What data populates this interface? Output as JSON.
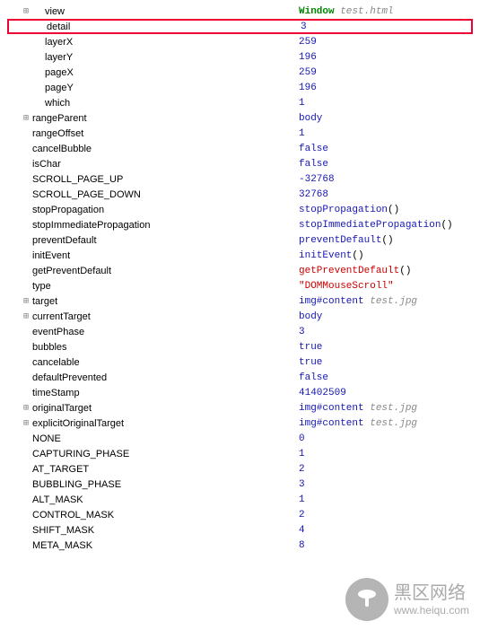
{
  "rows": [
    {
      "k": "view",
      "toggle": true,
      "indent": 0,
      "highlight": false,
      "parts": [
        {
          "t": "Window",
          "c": "v-green"
        },
        {
          "t": " test.html",
          "c": "v-gray"
        }
      ]
    },
    {
      "k": "detail",
      "toggle": false,
      "indent": 0,
      "highlight": true,
      "parts": [
        {
          "t": "3",
          "c": "v-num"
        }
      ]
    },
    {
      "k": "layerX",
      "toggle": false,
      "indent": 0,
      "highlight": false,
      "parts": [
        {
          "t": "259",
          "c": "v-num"
        }
      ]
    },
    {
      "k": "layerY",
      "toggle": false,
      "indent": 0,
      "highlight": false,
      "parts": [
        {
          "t": "196",
          "c": "v-num"
        }
      ]
    },
    {
      "k": "pageX",
      "toggle": false,
      "indent": 0,
      "highlight": false,
      "parts": [
        {
          "t": "259",
          "c": "v-num"
        }
      ]
    },
    {
      "k": "pageY",
      "toggle": false,
      "indent": 0,
      "highlight": false,
      "parts": [
        {
          "t": "196",
          "c": "v-num"
        }
      ]
    },
    {
      "k": "which",
      "toggle": false,
      "indent": 0,
      "highlight": false,
      "parts": [
        {
          "t": "1",
          "c": "v-num"
        }
      ]
    },
    {
      "k": "rangeParent",
      "toggle": true,
      "indent": -1,
      "highlight": false,
      "parts": [
        {
          "t": "body",
          "c": "v-num"
        }
      ]
    },
    {
      "k": "rangeOffset",
      "toggle": false,
      "indent": -1,
      "highlight": false,
      "parts": [
        {
          "t": "1",
          "c": "v-num"
        }
      ]
    },
    {
      "k": "cancelBubble",
      "toggle": false,
      "indent": -1,
      "highlight": false,
      "parts": [
        {
          "t": "false",
          "c": "v-bool"
        }
      ]
    },
    {
      "k": "isChar",
      "toggle": false,
      "indent": -1,
      "highlight": false,
      "parts": [
        {
          "t": "false",
          "c": "v-bool"
        }
      ]
    },
    {
      "k": "SCROLL_PAGE_UP",
      "toggle": false,
      "indent": -1,
      "highlight": false,
      "parts": [
        {
          "t": "-32768",
          "c": "v-num"
        }
      ]
    },
    {
      "k": "SCROLL_PAGE_DOWN",
      "toggle": false,
      "indent": -1,
      "highlight": false,
      "parts": [
        {
          "t": "32768",
          "c": "v-num"
        }
      ]
    },
    {
      "k": "stopPropagation",
      "toggle": false,
      "indent": -1,
      "highlight": false,
      "parts": [
        {
          "t": "stopPropagation",
          "c": "v-fn"
        },
        {
          "t": "()",
          "c": ""
        }
      ]
    },
    {
      "k": "stopImmediatePropagation",
      "toggle": false,
      "indent": -1,
      "highlight": false,
      "parts": [
        {
          "t": "stopImmediatePropagation",
          "c": "v-fn"
        },
        {
          "t": "()",
          "c": ""
        }
      ]
    },
    {
      "k": "preventDefault",
      "toggle": false,
      "indent": -1,
      "highlight": false,
      "parts": [
        {
          "t": "preventDefault",
          "c": "v-fn"
        },
        {
          "t": "()",
          "c": ""
        }
      ]
    },
    {
      "k": "initEvent",
      "toggle": false,
      "indent": -1,
      "highlight": false,
      "parts": [
        {
          "t": "initEvent",
          "c": "v-fn"
        },
        {
          "t": "()",
          "c": ""
        }
      ]
    },
    {
      "k": "getPreventDefault",
      "toggle": false,
      "indent": -1,
      "highlight": false,
      "parts": [
        {
          "t": "getPreventDefault",
          "c": "v-red-fn"
        },
        {
          "t": "()",
          "c": ""
        }
      ]
    },
    {
      "k": "type",
      "toggle": false,
      "indent": -1,
      "highlight": false,
      "parts": [
        {
          "t": "\"DOMMouseScroll\"",
          "c": "v-str"
        }
      ]
    },
    {
      "k": "target",
      "toggle": true,
      "indent": -1,
      "highlight": false,
      "parts": [
        {
          "t": "img#content",
          "c": "v-num"
        },
        {
          "t": " test.jpg",
          "c": "v-gray"
        }
      ]
    },
    {
      "k": "currentTarget",
      "toggle": true,
      "indent": -1,
      "highlight": false,
      "parts": [
        {
          "t": "body",
          "c": "v-num"
        }
      ]
    },
    {
      "k": "eventPhase",
      "toggle": false,
      "indent": -1,
      "highlight": false,
      "parts": [
        {
          "t": "3",
          "c": "v-num"
        }
      ]
    },
    {
      "k": "bubbles",
      "toggle": false,
      "indent": -1,
      "highlight": false,
      "parts": [
        {
          "t": "true",
          "c": "v-bool"
        }
      ]
    },
    {
      "k": "cancelable",
      "toggle": false,
      "indent": -1,
      "highlight": false,
      "parts": [
        {
          "t": "true",
          "c": "v-bool"
        }
      ]
    },
    {
      "k": "defaultPrevented",
      "toggle": false,
      "indent": -1,
      "highlight": false,
      "parts": [
        {
          "t": "false",
          "c": "v-bool"
        }
      ]
    },
    {
      "k": "timeStamp",
      "toggle": false,
      "indent": -1,
      "highlight": false,
      "parts": [
        {
          "t": "41402509",
          "c": "v-num"
        }
      ]
    },
    {
      "k": "originalTarget",
      "toggle": true,
      "indent": -1,
      "highlight": false,
      "parts": [
        {
          "t": "img#content",
          "c": "v-num"
        },
        {
          "t": " test.jpg",
          "c": "v-gray"
        }
      ]
    },
    {
      "k": "explicitOriginalTarget",
      "toggle": true,
      "indent": -1,
      "highlight": false,
      "parts": [
        {
          "t": "img#content",
          "c": "v-num"
        },
        {
          "t": " test.jpg",
          "c": "v-gray"
        }
      ]
    },
    {
      "k": "NONE",
      "toggle": false,
      "indent": -1,
      "highlight": false,
      "parts": [
        {
          "t": "0",
          "c": "v-num"
        }
      ]
    },
    {
      "k": "CAPTURING_PHASE",
      "toggle": false,
      "indent": -1,
      "highlight": false,
      "parts": [
        {
          "t": "1",
          "c": "v-num"
        }
      ]
    },
    {
      "k": "AT_TARGET",
      "toggle": false,
      "indent": -1,
      "highlight": false,
      "parts": [
        {
          "t": "2",
          "c": "v-num"
        }
      ]
    },
    {
      "k": "BUBBLING_PHASE",
      "toggle": false,
      "indent": -1,
      "highlight": false,
      "parts": [
        {
          "t": "3",
          "c": "v-num"
        }
      ]
    },
    {
      "k": "ALT_MASK",
      "toggle": false,
      "indent": -1,
      "highlight": false,
      "parts": [
        {
          "t": "1",
          "c": "v-num"
        }
      ]
    },
    {
      "k": "CONTROL_MASK",
      "toggle": false,
      "indent": -1,
      "highlight": false,
      "parts": [
        {
          "t": "2",
          "c": "v-num"
        }
      ]
    },
    {
      "k": "SHIFT_MASK",
      "toggle": false,
      "indent": -1,
      "highlight": false,
      "parts": [
        {
          "t": "4",
          "c": "v-num"
        }
      ]
    },
    {
      "k": "META_MASK",
      "toggle": false,
      "indent": -1,
      "highlight": false,
      "parts": [
        {
          "t": "8",
          "c": "v-num"
        }
      ]
    }
  ],
  "watermark": {
    "main": "黑区网络",
    "sub": "www.heiqu.com"
  }
}
